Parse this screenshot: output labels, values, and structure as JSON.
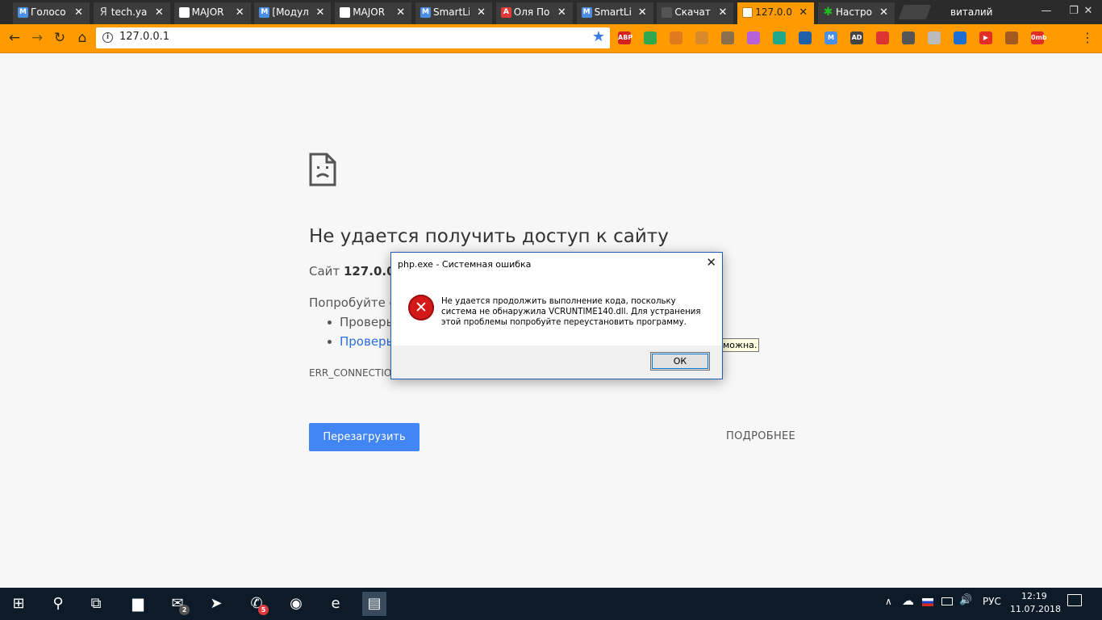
{
  "tabs": [
    {
      "title": "Голосо",
      "favicon": "M",
      "favicon_type": "majordomo-icon",
      "active": false
    },
    {
      "title": "tech.ya",
      "favicon": "Я",
      "favicon_type": "yandex-icon",
      "active": false
    },
    {
      "title": "MAJOR",
      "favicon": "",
      "favicon_type": "document-icon",
      "active": false
    },
    {
      "title": "[Модул",
      "favicon": "M",
      "favicon_type": "majordomo-icon",
      "active": false
    },
    {
      "title": "MAJOR",
      "favicon": "",
      "favicon_type": "document-icon",
      "active": false
    },
    {
      "title": "SmartLi",
      "favicon": "M",
      "favicon_type": "majordomo-icon",
      "active": false
    },
    {
      "title": "Оля По",
      "favicon": "A",
      "favicon_type": "red-a-icon",
      "active": false
    },
    {
      "title": "SmartLi",
      "favicon": "M",
      "favicon_type": "majordomo-icon",
      "active": false
    },
    {
      "title": "Скачат",
      "favicon": "",
      "favicon_type": "dark-page-icon",
      "active": false
    },
    {
      "title": "127.0.0",
      "favicon": "",
      "favicon_type": "page-icon",
      "active": true
    },
    {
      "title": "Настро",
      "favicon": "✱",
      "favicon_type": "gear-icon",
      "active": false
    }
  ],
  "user": {
    "name": "виталий"
  },
  "window_controls": {
    "minimize": "—",
    "maximize": "❐",
    "close": "✕"
  },
  "toolbar": {
    "back": "←",
    "forward": "→",
    "reload": "↻",
    "home": "⌂",
    "url": "127.0.0.1",
    "info": "i",
    "star": "★",
    "menu": "⋮"
  },
  "extensions": [
    {
      "name": "adblock-icon",
      "label": "ABP",
      "color": "#d71f1f"
    },
    {
      "name": "extension-icon-2",
      "label": "",
      "color": "#2fa84f"
    },
    {
      "name": "extension-icon-3",
      "label": "",
      "color": "#e07a1f"
    },
    {
      "name": "extension-icon-4",
      "label": "",
      "color": "#d88a2a"
    },
    {
      "name": "extension-icon-5",
      "label": "",
      "color": "#8a6d4a"
    },
    {
      "name": "extension-icon-6",
      "label": "",
      "color": "#b562d8"
    },
    {
      "name": "extension-icon-7",
      "label": "",
      "color": "#1fa88a"
    },
    {
      "name": "extension-icon-8",
      "label": "",
      "color": "#1f5fa8"
    },
    {
      "name": "extension-icon-9",
      "label": "M",
      "color": "#4a8ee6"
    },
    {
      "name": "extension-icon-10",
      "label": "AD",
      "color": "#444444"
    },
    {
      "name": "extension-icon-11",
      "label": "",
      "color": "#d33"
    },
    {
      "name": "extension-icon-12",
      "label": "",
      "color": "#555"
    },
    {
      "name": "extension-icon-13",
      "label": "",
      "color": "#bbbbbb"
    },
    {
      "name": "extension-icon-14",
      "label": "",
      "color": "#1c6fd1"
    },
    {
      "name": "extension-icon-15",
      "label": "▶",
      "color": "#e52d27"
    },
    {
      "name": "extension-icon-16",
      "label": "",
      "color": "#a35a1f"
    },
    {
      "name": "extension-icon-17",
      "label": "0mb",
      "color": "#e52d27"
    }
  ],
  "error_page": {
    "heading": "Не удается получить доступ к сайту",
    "site_prefix": "Сайт",
    "site": "127.0.0.1",
    "try_text": "Попробуйте сд",
    "bullets": [
      "Проверь",
      "Проверь"
    ],
    "error_code": "ERR_CONNECTION",
    "reload_label": "Перезагрузить",
    "details_label": "ПОДРОБНЕЕ",
    "tooltip_fragment": "можна."
  },
  "dialog": {
    "title": "php.exe - Системная ошибка",
    "message": "Не удается продолжить выполнение кода, поскольку система не обнаружила VCRUNTIME140.dll. Для устранения этой проблемы попробуйте переустановить программу.",
    "ok_label": "ОК",
    "icon": "✕"
  },
  "taskbar": {
    "apps": [
      {
        "name": "start-button",
        "glyph": "⊞",
        "badge": ""
      },
      {
        "name": "search-icon",
        "glyph": "⚲",
        "badge": ""
      },
      {
        "name": "task-view-icon",
        "glyph": "⧉",
        "badge": ""
      },
      {
        "name": "file-explorer-icon",
        "glyph": "▆",
        "badge": ""
      },
      {
        "name": "mail-icon",
        "glyph": "✉",
        "badge": "2"
      },
      {
        "name": "telegram-icon",
        "glyph": "➤",
        "badge": ""
      },
      {
        "name": "viber-icon",
        "glyph": "✆",
        "badge": "5"
      },
      {
        "name": "chrome-icon",
        "glyph": "◉",
        "badge": ""
      },
      {
        "name": "edge-icon",
        "glyph": "e",
        "badge": ""
      },
      {
        "name": "php-app-icon",
        "glyph": "▤",
        "badge": ""
      }
    ],
    "tray": {
      "chevron": "∧",
      "cloud": "☁",
      "language": "РУС",
      "volume": "🔊",
      "network": "▭"
    },
    "clock_time": "12:19",
    "clock_date": "11.07.2018"
  }
}
